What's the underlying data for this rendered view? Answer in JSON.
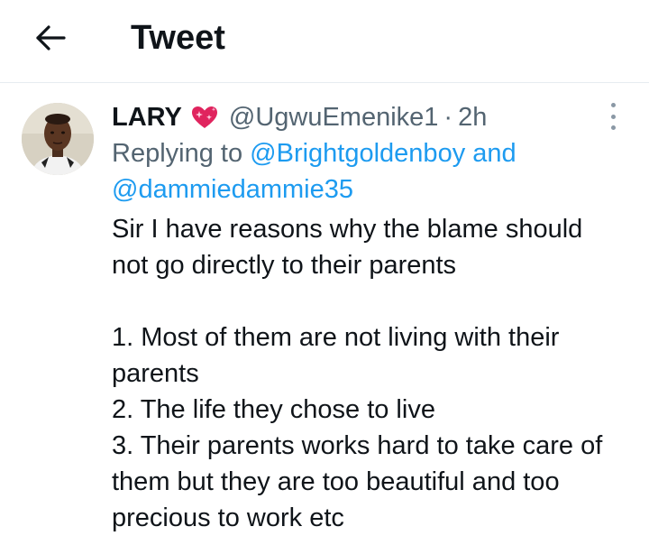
{
  "header": {
    "title": "Tweet",
    "back_icon": "arrow-left-icon"
  },
  "tweet": {
    "author_name": "LARY",
    "name_emoji_icon": "sparkling-heart-icon",
    "handle": "@UgwuEmenike1",
    "separator": "·",
    "time": "2h",
    "more_icon": "more-vertical-icon",
    "replying_prefix": "Replying to",
    "replying_mention_1": "@Brightgoldenboy",
    "replying_and": "and",
    "replying_mention_2": "@dammiedammie35",
    "body_line_1": "Sir I have reasons why the blame should not go directly to their parents",
    "item_1": "1. Most of them are not living with their parents",
    "item_2": "2. The life they chose to live",
    "item_3": "3. Their parents works hard to take care of them but they are too beautiful and too precious to work etc"
  },
  "colors": {
    "text": "#0f1419",
    "secondary": "#536471",
    "link": "#1d9bf0",
    "divider": "#e6ecf0",
    "heart": "#e0245e"
  }
}
